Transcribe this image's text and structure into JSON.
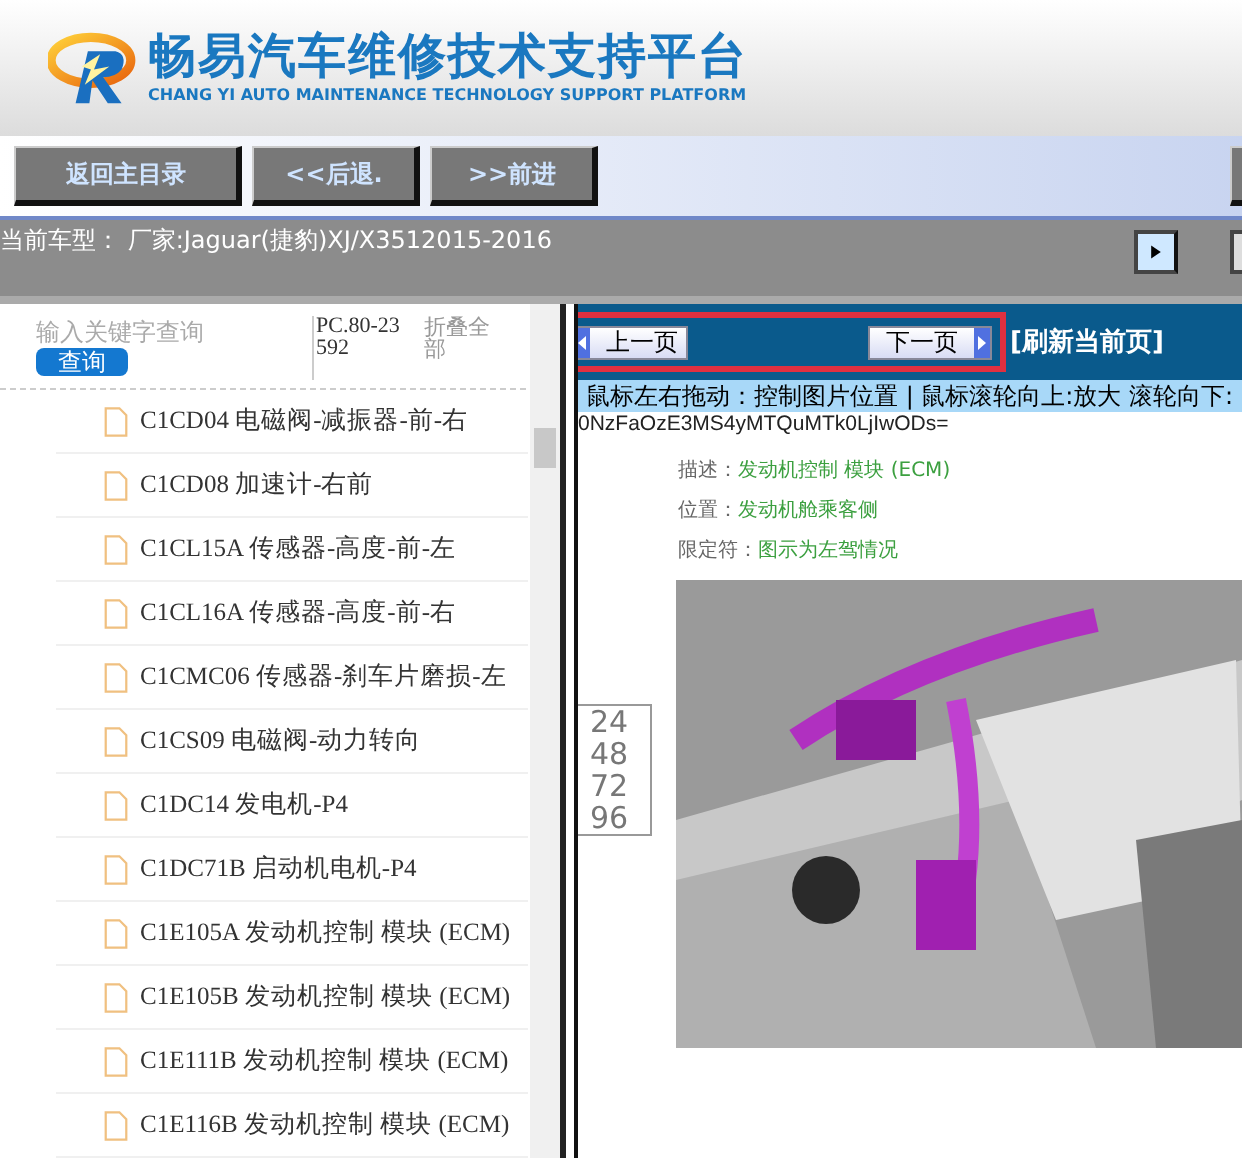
{
  "header": {
    "title": "畅易汽车维修技术支持平台",
    "subtitle": "CHANG YI AUTO MAINTENANCE TECHNOLOGY SUPPORT PLATFORM"
  },
  "toolbar": {
    "buttons": [
      {
        "label": "返回主目录"
      },
      {
        "label": "<<后退."
      },
      {
        "label": ">>前进"
      }
    ]
  },
  "vehicle_bar": {
    "text": "当前车型： 厂家:Jaguar(捷豹)XJ/X3512015-2016"
  },
  "sidebar": {
    "search": {
      "placeholder": "输入关键字查询",
      "button": "查询"
    },
    "code": "PC.80-23592",
    "collapse": "折叠全部",
    "items": [
      {
        "label": "C1CD04 电磁阀-减振器-前-右"
      },
      {
        "label": "C1CD08 加速计-右前"
      },
      {
        "label": "C1CL15A 传感器-高度-前-左"
      },
      {
        "label": "C1CL16A 传感器-高度-前-右"
      },
      {
        "label": "C1CMC06 传感器-刹车片磨损-左"
      },
      {
        "label": "C1CS09 电磁阀-动力转向"
      },
      {
        "label": "C1DC14 发电机-P4"
      },
      {
        "label": "C1DC71B 启动机电机-P4"
      },
      {
        "label": "C1E105A 发动机控制 模块 (ECM)"
      },
      {
        "label": "C1E105B 发动机控制 模块 (ECM)"
      },
      {
        "label": "C1E111B 发动机控制 模块 (ECM)"
      },
      {
        "label": "C1E116B 发动机控制 模块 (ECM)"
      }
    ]
  },
  "document": {
    "prev": "上一页",
    "next": "下一页",
    "refresh": "[刷新当前页]",
    "hint": "鼠标左右拖动：控制图片位置 | 鼠标滚轮向上:放大  滚轮向下:",
    "code": "0NzFaOzE3MS4yMTQuMTk0LjIwODs=",
    "fields": [
      {
        "label": "描述：",
        "value": "发动机控制 模块 (ECM)"
      },
      {
        "label": "位置：",
        "value": "发动机舱乘客侧"
      },
      {
        "label": "限定符：",
        "value": "图示为左驾情况"
      }
    ],
    "side_numbers": [
      "24",
      "48",
      "72",
      "96"
    ]
  }
}
